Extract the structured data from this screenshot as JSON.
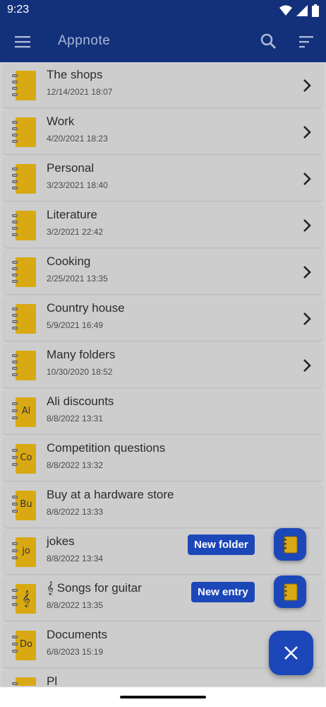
{
  "status_bar": {
    "time": "9:23"
  },
  "app_bar": {
    "title": "Appnote"
  },
  "items": [
    {
      "title": "The shops",
      "date": "12/14/2021 18:07",
      "type": "folder",
      "letters": ""
    },
    {
      "title": "Work",
      "date": "4/20/2021 18:23",
      "type": "folder",
      "letters": ""
    },
    {
      "title": "Personal",
      "date": "3/23/2021 18:40",
      "type": "folder",
      "letters": ""
    },
    {
      "title": "Literature",
      "date": "3/2/2021 22:42",
      "type": "folder",
      "letters": ""
    },
    {
      "title": "Cooking",
      "date": "2/25/2021 13:35",
      "type": "folder",
      "letters": ""
    },
    {
      "title": "Country house",
      "date": "5/9/2021 16:49",
      "type": "folder",
      "letters": ""
    },
    {
      "title": "Many folders",
      "date": "10/30/2020 18:52",
      "type": "folder",
      "letters": ""
    },
    {
      "title": "Ali discounts",
      "date": "8/8/2022 13:31",
      "type": "entry",
      "letters": "Al"
    },
    {
      "title": "Competition questions",
      "date": "8/8/2022 13:32",
      "type": "entry",
      "letters": "Co"
    },
    {
      "title": "Buy at a hardware store",
      "date": "8/8/2022 13:33",
      "type": "entry",
      "letters": "Bu"
    },
    {
      "title": "jokes",
      "date": "8/8/2022 13:34",
      "type": "entry",
      "letters": "jo"
    },
    {
      "title": "𝄞 Songs for guitar",
      "date": "8/8/2022 13:35",
      "type": "entry",
      "letters": "𝄞"
    },
    {
      "title": "Documents",
      "date": "6/8/2023 15:19",
      "type": "entry",
      "letters": "Do"
    },
    {
      "title": "Pl",
      "date": "",
      "type": "entry",
      "letters": ""
    }
  ],
  "fab": {
    "new_folder_label": "New folder",
    "new_entry_label": "New entry"
  },
  "colors": {
    "primary": "#13307a",
    "accent": "#1c47b8",
    "notebook": "#d9a914"
  }
}
